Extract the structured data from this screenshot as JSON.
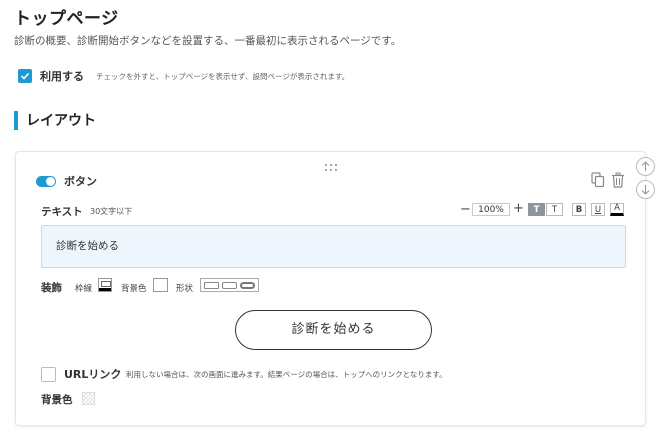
{
  "page": {
    "title": "トップページ",
    "description": "診断の概要、診断開始ボタンなどを設置する、一番最初に表示されるページです。"
  },
  "use_setting": {
    "label": "利用する",
    "hint": "チェックを外すと、トップページを表示せず、設問ページが表示されます。",
    "checked": true
  },
  "layout_section": {
    "title": "レイアウト"
  },
  "button_block": {
    "title": "ボタン",
    "enabled": true,
    "text_label": "テキスト",
    "text_limit": "30文字以下",
    "zoom_minus": "−",
    "zoom_value": "100%",
    "zoom_plus": "+",
    "format_buttons": [
      {
        "label": "T",
        "name": "text-bold-button",
        "active": true
      },
      {
        "label": "T",
        "name": "text-normal-button",
        "active": false
      },
      {
        "label": "B",
        "name": "bold-button",
        "active": false
      },
      {
        "label": "U",
        "name": "underline-button",
        "active": false
      },
      {
        "label": "A",
        "name": "font-color-button",
        "active": false
      }
    ],
    "text_value": "診断を始める",
    "decoration_label": "装飾",
    "border_label": "枠線",
    "bg_color_label": "背景色",
    "shape_label": "形状",
    "preview_label": "診断を始める",
    "url_link_label": "URLリンク",
    "url_link_hint": "利用しない場合は、次の画面に進みます。結果ページの場合は、トップへのリンクとなります。",
    "url_link_checked": false,
    "background_label": "背景色"
  },
  "colors": {
    "accent": "#1d9bd1",
    "input_bg": "#eef5fd",
    "active_format": "#8e959b"
  },
  "icons": [
    "check-icon",
    "drag-handle-icon",
    "copy-icon",
    "trash-icon",
    "arrow-up-icon",
    "arrow-down-icon"
  ]
}
